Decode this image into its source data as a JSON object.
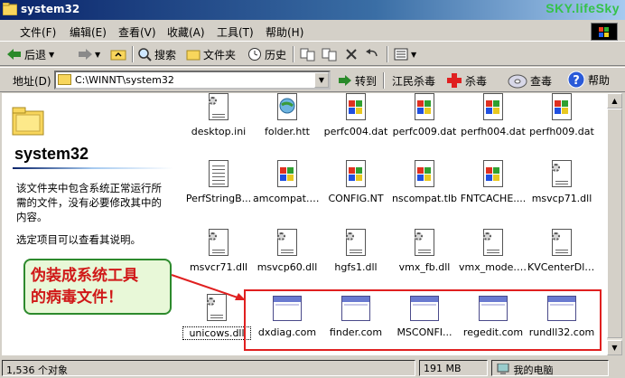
{
  "window": {
    "title": "system32",
    "watermark": "SKY.lifeSky"
  },
  "menu": [
    "文件(F)",
    "编辑(E)",
    "查看(V)",
    "收藏(A)",
    "工具(T)",
    "帮助(H)"
  ],
  "toolbar": {
    "back": "后退",
    "search": "搜索",
    "folders": "文件夹",
    "history": "历史"
  },
  "address": {
    "label": "地址(D)",
    "value": "C:\\WINNT\\system32",
    "go": "转到"
  },
  "antivirus": {
    "jiangmin": "江民杀毒",
    "kill": "杀毒",
    "scan": "查毒",
    "help": "帮助"
  },
  "leftpane": {
    "title": "system32",
    "description": "该文件夹中包含系统正常运行所需的文件，没有必要修改其中的内容。",
    "hint": "选定项目可以查看其说明。"
  },
  "files": [
    {
      "name": "desktop.ini",
      "icon": "ini-gear-icon"
    },
    {
      "name": "folder.htt",
      "icon": "htt-globe-icon"
    },
    {
      "name": "perfc004.dat",
      "icon": "dat-windows-icon"
    },
    {
      "name": "perfc009.dat",
      "icon": "dat-windows-icon"
    },
    {
      "name": "perfh004.dat",
      "icon": "dat-windows-icon"
    },
    {
      "name": "perfh009.dat",
      "icon": "dat-windows-icon"
    },
    {
      "name": "PerfStringB...",
      "icon": "document-icon"
    },
    {
      "name": "amcompat.tlb",
      "icon": "tlb-windows-icon"
    },
    {
      "name": "CONFIG.NT",
      "icon": "windows-icon"
    },
    {
      "name": "nscompat.tlb",
      "icon": "tlb-windows-icon"
    },
    {
      "name": "FNTCACHE....",
      "icon": "windows-icon"
    },
    {
      "name": "msvcp71.dll",
      "icon": "dll-gear-icon"
    },
    {
      "name": "msvcr71.dll",
      "icon": "dll-gear-icon"
    },
    {
      "name": "msvcp60.dll",
      "icon": "dll-gear-icon"
    },
    {
      "name": "hgfs1.dll",
      "icon": "dll-gear-icon"
    },
    {
      "name": "vmx_fb.dll",
      "icon": "dll-gear-icon"
    },
    {
      "name": "vmx_mode.dll",
      "icon": "dll-gear-icon"
    },
    {
      "name": "KVCenterDll....",
      "icon": "dll-gear-icon"
    },
    {
      "name": "unicows.dll",
      "icon": "dll-gear-icon"
    },
    {
      "name": "dxdiag.com",
      "icon": "application-icon"
    },
    {
      "name": "finder.com",
      "icon": "application-icon"
    },
    {
      "name": "MSCONFI...",
      "icon": "application-icon"
    },
    {
      "name": "regedit.com",
      "icon": "application-icon"
    },
    {
      "name": "rundll32.com",
      "icon": "application-icon"
    }
  ],
  "annotation": {
    "line1": "伪装成系统工具",
    "line2": "的病毒文件！",
    "box_color": "#e02020",
    "callout_color": "#2d8a2d"
  },
  "status": {
    "count": "1,536 个对象",
    "size": "191 MB",
    "location": "我的电脑"
  }
}
